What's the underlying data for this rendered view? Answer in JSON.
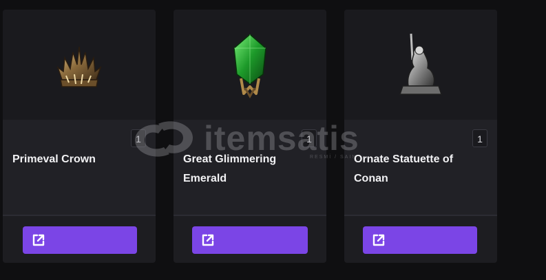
{
  "cards": [
    {
      "title": "Primeval Crown",
      "quantity": "1",
      "item_icon": "crown-icon",
      "button_icon": "external-link-icon"
    },
    {
      "title": "Great Glimmering Emerald",
      "quantity": "1",
      "item_icon": "emerald-icon",
      "button_icon": "external-link-icon"
    },
    {
      "title": "Ornate Statuette of Conan",
      "quantity": "1",
      "item_icon": "statuette-icon",
      "button_icon": "external-link-icon"
    }
  ],
  "watermark": {
    "brand": "itemsatis",
    "sub": "RESMİ / SAIN"
  },
  "colors": {
    "background": "#0f0f11",
    "card": "#1d1d21",
    "accent": "#7b45e6",
    "text": "#f2f2f4"
  }
}
